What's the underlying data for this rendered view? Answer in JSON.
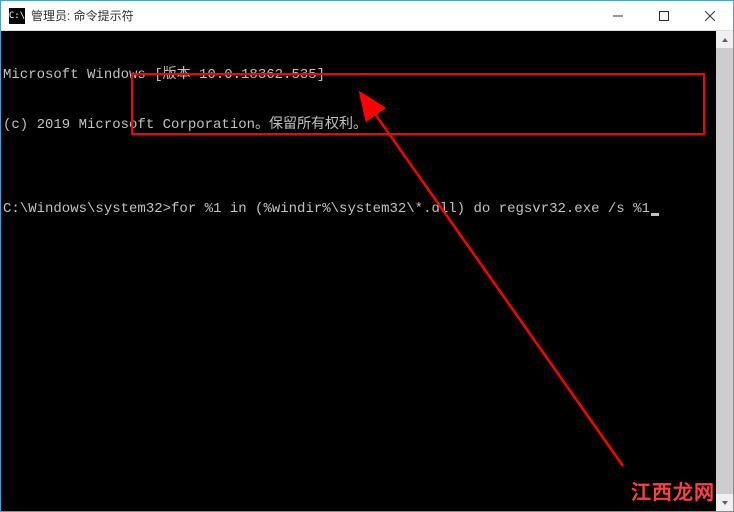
{
  "window": {
    "title": "管理员: 命令提示符",
    "icon_label": "C:\\"
  },
  "terminal": {
    "line1": "Microsoft Windows [版本 10.0.18362.535]",
    "line2": "(c) 2019 Microsoft Corporation。保留所有权利。",
    "blank": "",
    "prompt": "C:\\Windows\\system32>",
    "command": "for %1 in (%windir%\\system32\\*.dll) do regsvr32.exe /s %1"
  },
  "watermark": "江西龙网",
  "colors": {
    "accent_red": "#ff0000",
    "terminal_bg": "#000000",
    "terminal_fg": "#c0c0c0"
  }
}
